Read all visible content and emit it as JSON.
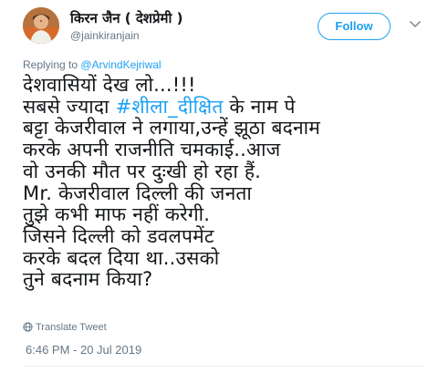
{
  "author": {
    "name": "किरन जैन ( देशप्रेमी )",
    "handle": "@jainkiranjain"
  },
  "follow_button": {
    "label": "Follow"
  },
  "reply": {
    "prefix": "Replying to",
    "handle": "@ArvindKejriwal"
  },
  "tweet": {
    "lines": [
      "देशवासियों देख लो...!!!",
      "सबसे ज्यादा",
      "बट्टा केजरीवाल ने लगाया,उन्हें झूठा बदनाम",
      "करके अपनी राजनीति चमकाई..आज",
      "वो उनकी मौत पर दुःखी हो रहा हैं.",
      "Mr. केजरीवाल दिल्ली की जनता",
      "तुझे कभी माफ नहीं करेगी.",
      "जिसने दिल्ली को डवलपमेंट",
      "करके बदल दिया था..उसको",
      "तुने बदनाम किया?"
    ],
    "hashtag": "#शीला_दीक्षित",
    "line2_suffix": "के नाम पे"
  },
  "translate": {
    "label": "Translate Tweet",
    "icon": "globe-icon"
  },
  "timestamp": "6:46 PM - 20 Jul 2019",
  "colors": {
    "accent": "#1da1f2",
    "secondary_text": "#657786",
    "primary_text": "#14171a"
  }
}
